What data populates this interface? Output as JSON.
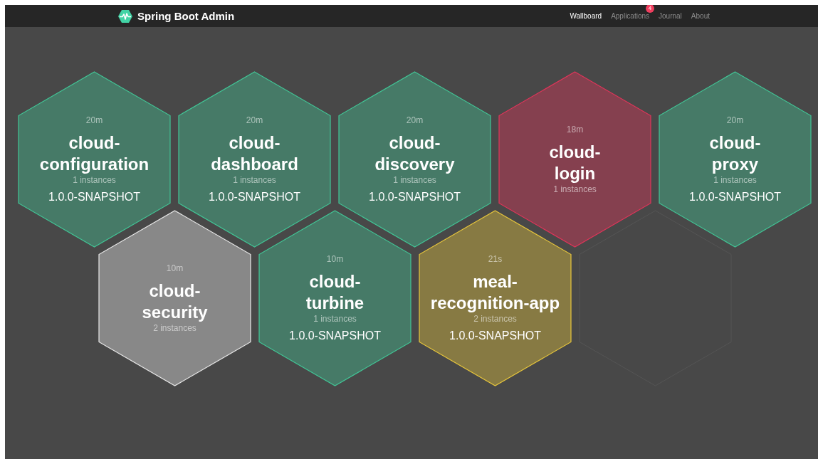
{
  "navbar": {
    "brand": "Spring Boot Admin",
    "links": [
      {
        "label": "Wallboard",
        "selected": true
      },
      {
        "label": "Applications",
        "selected": false,
        "badge": "4"
      },
      {
        "label": "Journal",
        "selected": false
      },
      {
        "label": "About",
        "selected": false
      }
    ]
  },
  "wallboard": {
    "rows": [
      [
        {
          "kind": "application",
          "color": "#42c596",
          "time": "20m",
          "name": "cloud-configuration",
          "instances": "1 instances",
          "version": "1.0.0-SNAPSHOT"
        },
        {
          "kind": "application",
          "color": "#42c596",
          "time": "20m",
          "name": "cloud-dashboard",
          "instances": "1 instances",
          "version": "1.0.0-SNAPSHOT"
        },
        {
          "kind": "application",
          "color": "#42c596",
          "time": "20m",
          "name": "cloud-discovery",
          "instances": "1 instances",
          "version": "1.0.0-SNAPSHOT"
        },
        {
          "kind": "application",
          "color": "#e0355a",
          "time": "18m",
          "name": "cloud-login",
          "instances": "1 instances"
        },
        {
          "kind": "application",
          "color": "#42c596",
          "time": "20m",
          "name": "cloud-proxy",
          "instances": "1 instances",
          "version": "1.0.0-SNAPSHOT"
        }
      ],
      [
        {
          "kind": "application",
          "color": "#e8e8e8",
          "time": "10m",
          "name": "cloud-security",
          "instances": "2 instances"
        },
        {
          "kind": "application",
          "color": "#42c596",
          "time": "10m",
          "name": "cloud-turbine",
          "instances": "1 instances",
          "version": "1.0.0-SNAPSHOT"
        },
        {
          "kind": "application",
          "color": "#e6c53c",
          "time": "21s",
          "name": "meal-recognition-app",
          "instances": "2 instances",
          "version": "1.0.0-SNAPSHOT"
        },
        {
          "kind": "empty"
        }
      ]
    ]
  }
}
